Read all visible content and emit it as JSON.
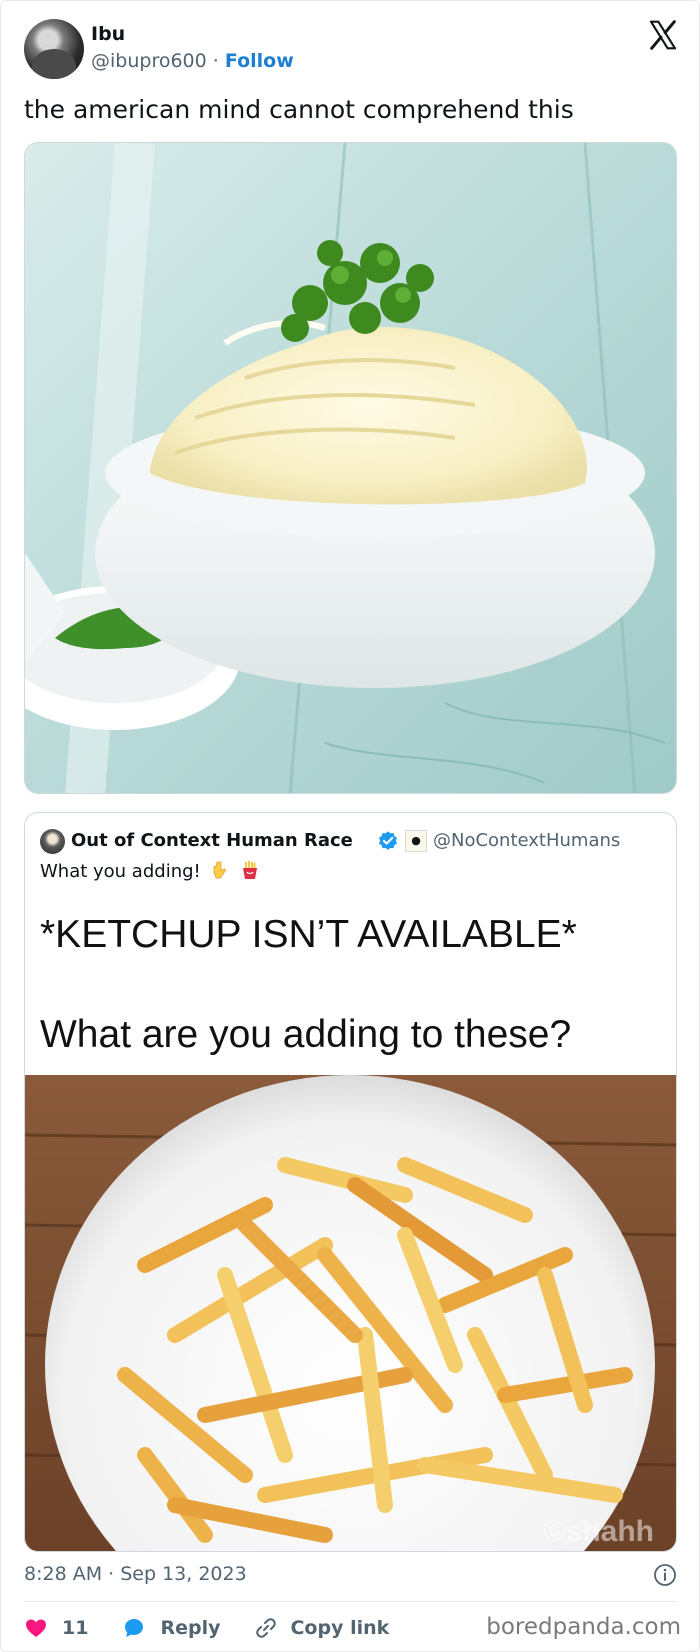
{
  "author": {
    "name": "Ibu",
    "handle": "@ibupro600",
    "separator": "·",
    "follow_label": "Follow"
  },
  "tweet": {
    "text": "the american mind cannot comprehend this"
  },
  "quoted_tweet": {
    "name": "Out of Context Human Race",
    "handle": "@NoContextHumans",
    "text": "What you adding!",
    "meme_line_1": "*KETCHUP ISN’T AVAILABLE*",
    "meme_line_2": "What are you adding to these?",
    "watermark": "©shahh"
  },
  "footer": {
    "timestamp": "8:28 AM · Sep 13, 2023",
    "like_count": "11",
    "reply_label": "Reply",
    "copy_link_label": "Copy link",
    "brand": "boredpanda.com"
  },
  "colors": {
    "link_blue": "#1d7fd1",
    "like_pink": "#f91880",
    "verified_blue": "#1d9bf0",
    "muted": "#536471"
  },
  "icons": [
    "x-logo-icon",
    "verified-badge-icon",
    "pointing-down-emoji-icon",
    "fries-emoji-icon",
    "info-icon",
    "heart-icon",
    "reply-bubble-icon",
    "link-icon"
  ]
}
